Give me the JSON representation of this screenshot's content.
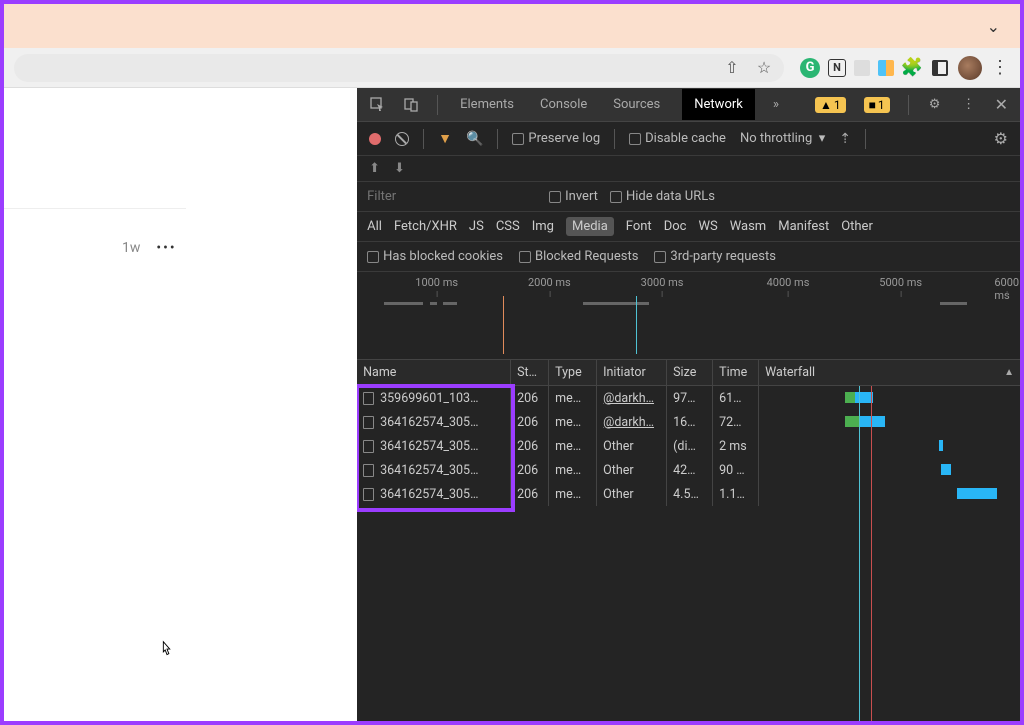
{
  "notif": {
    "chevron": "⌄"
  },
  "toolbar": {
    "share_glyph": "⇧",
    "star_glyph": "☆",
    "ext_g": "G",
    "ext_n": "N",
    "vdots": "⋮"
  },
  "page": {
    "timestamp": "1w",
    "more": "•••"
  },
  "devtools": {
    "tabs": {
      "elements": "Elements",
      "console": "Console",
      "sources": "Sources",
      "network": "Network"
    },
    "more_glyph": "»",
    "warn_count": "1",
    "issue_count": "1",
    "gear_glyph": "⚙",
    "vdots": "⋮",
    "close": "✕"
  },
  "netbar": {
    "preserve": "Preserve log",
    "disable_cache": "Disable cache",
    "throttling": "No throttling",
    "gear": "⚙"
  },
  "updown": {
    "up": "⬆",
    "down": "⬇"
  },
  "filter": {
    "placeholder": "Filter",
    "invert": "Invert",
    "hide_data": "Hide data URLs",
    "types": {
      "all": "All",
      "fetch": "Fetch/XHR",
      "js": "JS",
      "css": "CSS",
      "img": "Img",
      "media": "Media",
      "font": "Font",
      "doc": "Doc",
      "ws": "WS",
      "wasm": "Wasm",
      "manifest": "Manifest",
      "other": "Other"
    },
    "blocked_cookies": "Has blocked cookies",
    "blocked_req": "Blocked Requests",
    "third_party": "3rd-party requests"
  },
  "timeline": {
    "ticks": [
      "1000 ms",
      "2000 ms",
      "3000 ms",
      "4000 ms",
      "5000 ms",
      "6000 ms"
    ]
  },
  "table": {
    "headers": {
      "name": "Name",
      "status": "St…",
      "type": "Type",
      "initiator": "Initiator",
      "size": "Size",
      "time": "Time",
      "waterfall": "Waterfall"
    },
    "rows": [
      {
        "name": "359699601_103…",
        "status": "206",
        "type": "me…",
        "initiator": "@darkh…",
        "init_link": true,
        "size": "97…",
        "time": "61…"
      },
      {
        "name": "364162574_305…",
        "status": "206",
        "type": "me…",
        "initiator": "@darkh…",
        "init_link": true,
        "size": "16…",
        "time": "72…"
      },
      {
        "name": "364162574_305…",
        "status": "206",
        "type": "me…",
        "initiator": "Other",
        "init_link": false,
        "size": "(di…",
        "time": "2 ms"
      },
      {
        "name": "364162574_305…",
        "status": "206",
        "type": "me…",
        "initiator": "Other",
        "init_link": false,
        "size": "42…",
        "time": "90 …"
      },
      {
        "name": "364162574_305…",
        "status": "206",
        "type": "me…",
        "initiator": "Other",
        "init_link": false,
        "size": "4.5…",
        "time": "1.1…"
      }
    ]
  }
}
